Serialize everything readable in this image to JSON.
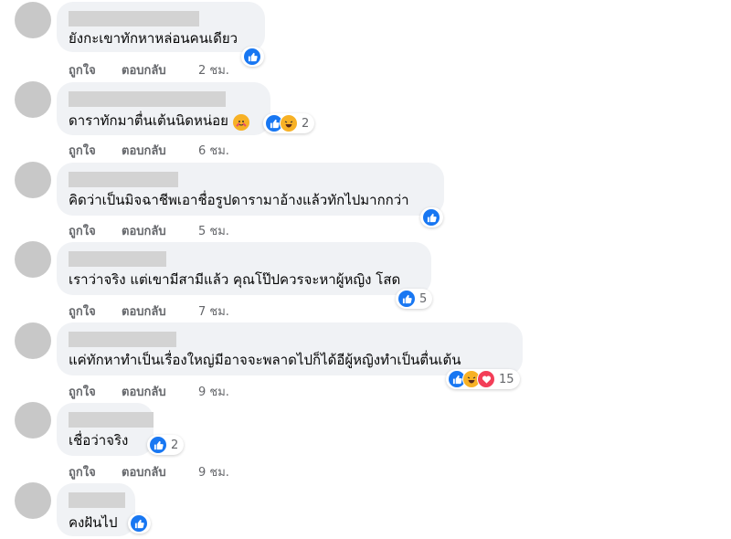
{
  "actions": {
    "like_label": "ถูกใจ",
    "reply_label": "ตอบกลับ"
  },
  "colors": {
    "like": "#1877f2",
    "haha": "#f7b125",
    "love": "#f33e58",
    "care": "#f7b125",
    "bubble": "#f0f2f5"
  },
  "comments": [
    {
      "text": "ยังกะเขาทักหาหล่อนคนเดียว",
      "time": "2 ชม.",
      "reactions": [
        "like-icon"
      ],
      "count": ""
    },
    {
      "text": "ดาราทักมาตื่นเต้นนิดหน่อย",
      "time": "6 ชม.",
      "emoji": "care-emoji",
      "reactions": [
        "like-icon",
        "haha-icon"
      ],
      "count": "2"
    },
    {
      "text": "คิดว่าเป็นมิจฉาชีพเอาชื่อรูปดารามาอ้างแล้วทักไปมากกว่า",
      "time": "5 ชม.",
      "reactions": [
        "like-icon"
      ],
      "count": ""
    },
    {
      "text": "เราว่าจริง แต่เขามีสามีแล้ว คุณโป๊ปควรจะหาผู้หญิง โสด",
      "time": "7 ชม.",
      "reactions": [
        "like-icon"
      ],
      "count": "5"
    },
    {
      "text": "แค่ทักหาทำเป็นเรื่องใหญ่มีอาจจะพลาดไปก็ได้อีผู้หญิงทำเป็นตื่นเต้น",
      "time": "9 ชม.",
      "reactions": [
        "like-icon",
        "haha-icon",
        "love-icon"
      ],
      "count": "15"
    },
    {
      "text": "เชื่อว่าจริง",
      "time": "9 ชม.",
      "reactions": [
        "like-icon"
      ],
      "count": "2"
    },
    {
      "text": "คงฝันไป",
      "time": "",
      "reactions": [
        "like-icon"
      ],
      "count": ""
    }
  ]
}
